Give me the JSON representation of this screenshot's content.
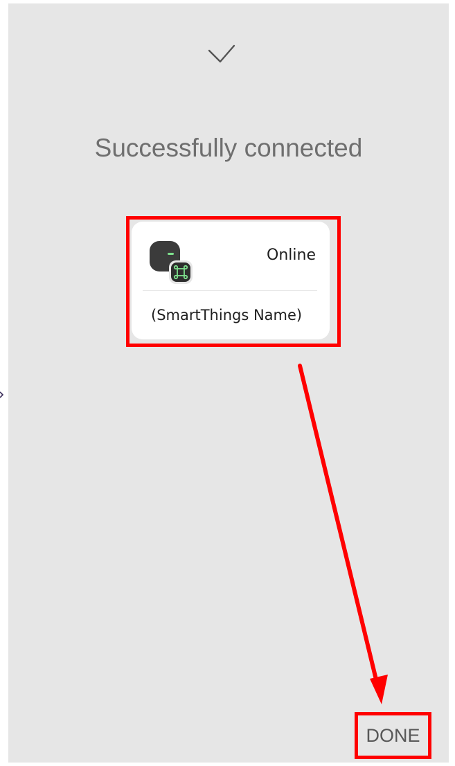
{
  "header": {
    "check_icon": "checkmark-icon",
    "title": "Successfully connected"
  },
  "device_card": {
    "icon": "smartthings-hub-icon",
    "status": "Online",
    "name": "(SmartThings Name)"
  },
  "actions": {
    "done_label": "DONE"
  },
  "annotation": {
    "highlight_color": "#ff0000"
  },
  "colors": {
    "background": "#e6e6e6",
    "card": "#ffffff"
  }
}
